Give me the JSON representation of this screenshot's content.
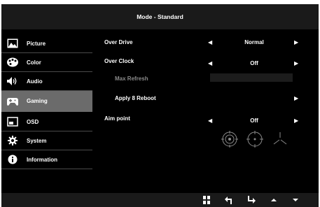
{
  "header": {
    "title": "Mode - Standard"
  },
  "sidebar": {
    "items": [
      {
        "label": "Picture",
        "icon": "picture-icon"
      },
      {
        "label": "Color",
        "icon": "palette-icon"
      },
      {
        "label": "Audio",
        "icon": "speaker-icon"
      },
      {
        "label": "Gaming",
        "icon": "gamepad-icon",
        "active": true
      },
      {
        "label": "OSD",
        "icon": "osd-window-icon"
      },
      {
        "label": "System",
        "icon": "gear-icon"
      },
      {
        "label": "Information",
        "icon": "info-icon"
      }
    ]
  },
  "main": {
    "over_drive": {
      "label": "Over Drive",
      "value": "Normal"
    },
    "over_clock": {
      "label": "Over Clock",
      "value": "Off"
    },
    "max_refresh": {
      "label": "Max Refresh"
    },
    "apply_reboot": {
      "label": "Apply 8 Reboot"
    },
    "aim_point": {
      "label": "Aim point",
      "value": "Off",
      "styles": [
        "crosshair-circle-icon",
        "crosshair-dot-icon",
        "crosshair-tripod-icon"
      ]
    }
  },
  "navbar": {
    "buttons": [
      "menu-grid-icon",
      "back-icon",
      "enter-icon",
      "up-icon",
      "down-icon"
    ]
  },
  "colors": {
    "background": "#000000",
    "bar": "#1a1a1a",
    "active": "#6b6b6b",
    "text": "#ffffff",
    "dim_text": "#8a8a8a"
  }
}
